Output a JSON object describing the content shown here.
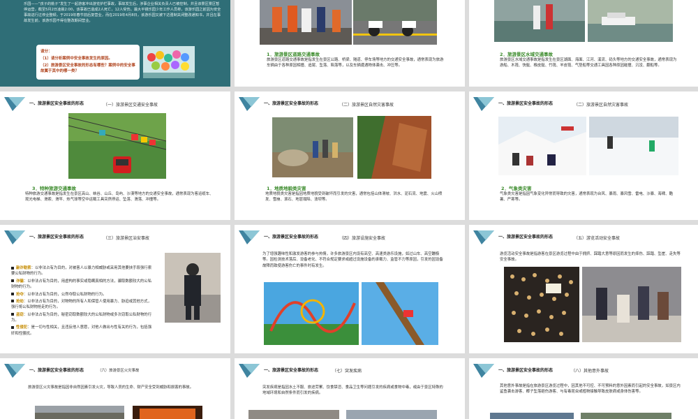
{
  "slide_row1_left": {
    "case_text": "乐园——“孩子的桃子”发生了一起游客冲出游览护栏事故，事故发生后，涉事企业相关负责人已被控制，并且该景区景区暂停运营，截至5月2日凌晨2:00，该事故已造成2人死亡，12人受伤。最大平镜乐园少年工作人员称，该游乐园之前因为安全事故进行过停业整顿，于2019年春节前后复营业，而在2019年4月8日，该游乐园又被下达强制关闭整改通知书，并且在事故发生前，该游乐园不得在整改期间营业。",
    "q_title": "请分：",
    "q1": "（1）请分析案例中安全事故发生的原因。",
    "q2": "（2）旅游景区安全事故的形态有哪些？案例中的安全事故属于其中的哪一类？"
  },
  "slide_row1_mid": {
    "caption": "1．旅游景区道路交通事故",
    "text": "旅游景区道路交通事故是指发生在景区公路、桥梁、隧道、停车场等地方的交通安全事故，通常表现为旅游车辆由于各种原因相撞、追尾、坠落、陷落等，以及车辆遭遇物体袭击、冲压等。"
  },
  "slide_row1_right": {
    "caption": "2．旅游景区水域交通事故",
    "text": "旅游景区水域交通事故是指发生在景区湖面、海面、江河、溪流、码头等地方的交通安全事故，通常表现为游船、木筏、快艇、橡皮艇、竹筏、羊皮筏、气垫船等交通工具因各种原因碰撞、沉没、翻船等。"
  },
  "slide_row2_left": {
    "title": "一、旅游景区安全事故的形态",
    "sub": "（一）旅游景区交通安全事故",
    "caption": "3．特种旅游交通事故",
    "text": "特种旅游交通事故是指发生在景区高山、峡谷、山丘、岛屿、沙漠等地方的交通安全事故，通常表现为客运缆车、观光电梯、滑索、滑竿、热气球等空中运载工具突然停运、坠落、滑落、冲撞等。"
  },
  "slide_row2_mid": {
    "title": "一、旅游景区安全事故的形态",
    "sub": "（二）旅游景区自然灾害事故",
    "caption": "1．地质地貌类灾害",
    "text": "地质地貌类灾害是指因地质地貌受到破坏而引发的灾害，通常包括山体滑坡、洪水、泥石流、地震、火山喷发、雪崩、滚石、地层塌陷、溃坝等。"
  },
  "slide_row2_right": {
    "title": "一、旅游景区安全事故的形态",
    "sub": "（二）旅游景区自然灾害事故",
    "caption": "2．气象类灾害",
    "text": "气象类灾害是指因气象变化异常而导致的灾害，通常表现为台风、暴雨、暴风雪、雷电、沙暴、海啸、酷暑、严寒等。"
  },
  "slide_row3_left": {
    "title": "一、旅游景区安全事故的形态",
    "sub": "（三）旅游景区治安事故",
    "items": [
      {
        "kw": "敲诈勒索",
        "text": "：以非法占有为目的，对被害人以暴力相威胁或采用其他要挟手段强行索要公私财物的行为。"
      },
      {
        "kw": "诈骗",
        "text": "：以非法占有为目的，用虚构的事实或隐瞒真相的方法，骗取数额较大的公私财物的行为。"
      },
      {
        "kw": "抢夺",
        "text": "：以非法占有为目的，公然夺取公私财物的行为。"
      },
      {
        "kw": "抢劫",
        "text": "：以非法占有为目的，对物物的所有人和保管人使用暴力、胁迫或其他方式，强行将公私财物抢走的行为。"
      },
      {
        "kw": "盗窃",
        "text": "：以非法占有为目的，秘密窃取数额较大的公私财物或多次窃取公私财物的行为。"
      },
      {
        "kw": "性侵犯",
        "text": "：是一切与性相关，且违反他人意愿，对他人做出与性有关的行为，包括强奸和性骚扰。"
      }
    ]
  },
  "slide_row3_mid": {
    "title": "一、旅游景区安全事故的形态",
    "sub": "（四）旅游设施安全事故",
    "text": "为了增强趣味性和激发游客的参与热情，许多旅游景区内设有高空、高速类游乐设施，如过山车、高空蹦极等。因检测技术落后、设备老化、不符合规定要求或超过设施设备的承载力、监管不力等原因，引发的因设备故障而致使游客伤亡的事件时有发生。"
  },
  "slide_row3_right": {
    "title": "一、旅游景区安全事故的形态",
    "sub": "（五）游览活动安全事故",
    "text": "游览活动安全事故是指游客在景区游览过程中由于拥挤、踩踏大意等原因而发生的摔伤、踩踏、坠崖、走失等安全事故。"
  },
  "slide_row4_left": {
    "title": "一、旅游景区安全事故的形态",
    "sub": "（六）旅游景区火灾事故",
    "text": "旅游景区火灾事故是指因非自然因素引发火灾，导致人员的生命、财产安全受到威胁和损害的事故。"
  },
  "slide_row4_mid": {
    "title": "一、旅游景区安全事故的形态",
    "sub": "（七）突发疾病",
    "text": "突发疾病是指因水土不服、旅途劳累、饮食禁忌、食品卫生等问题引发的疾病或食物中毒，或由于景区特殊的地域环境和自然条件而引发的疾病。"
  },
  "slide_row4_right": {
    "title": "一、旅游景区安全事故的形态",
    "sub": "（八）其他意外事故",
    "text": "其他意外事故是指在旅游景区游览过程中，因其他不可控、不可预料的意外因素而引起的安全事故，如景区内鲨鱼袭击游客、椰子坠落砸伤游客、与有毒昆虫或植物接触导致皮肤病或身体伤害等。"
  },
  "colors": {
    "accent": "#3a8a2a",
    "teal": "#2b6b72",
    "keyword": "#c58b00"
  }
}
